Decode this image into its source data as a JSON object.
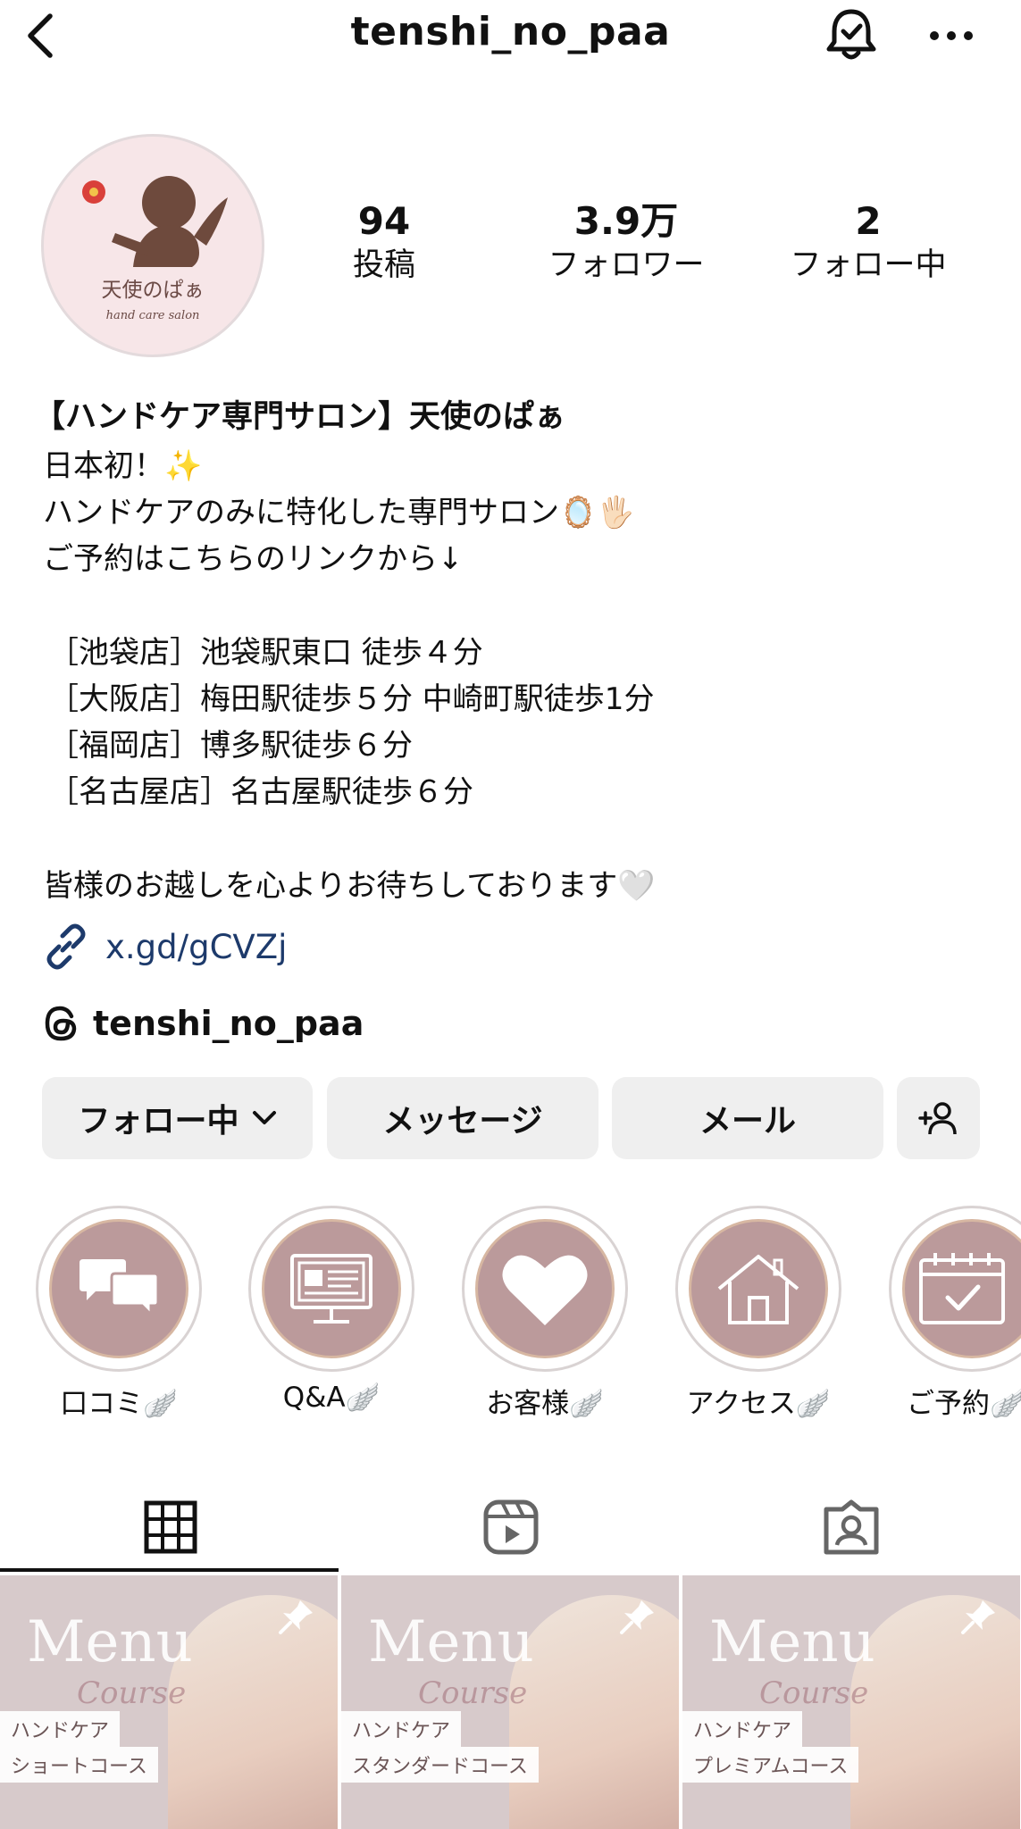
{
  "header": {
    "username": "tenshi_no_paa",
    "icons": {
      "back": "chevron-left-icon",
      "bell": "bell-check-icon",
      "more": "more-horizontal-icon"
    }
  },
  "profile": {
    "avatar": {
      "title": "天使のぱぁ",
      "subtitle": "hand care salon"
    },
    "stats": [
      {
        "value": "94",
        "label": "投稿"
      },
      {
        "value": "3.9万",
        "label": "フォロワー"
      },
      {
        "value": "2",
        "label": "フォロー中"
      }
    ],
    "full_name": "【ハンドケア専門サロン】天使のぱぁ",
    "bio": [
      "日本初！✨",
      "ハンドケアのみに特化した専門サロン🪞🖐🏻",
      "ご予約はこちらのリンクから↓",
      "［池袋店］池袋駅東口 徒歩４分",
      "［大阪店］梅田駅徒歩５分 中崎町駅徒歩1分",
      "［福岡店］博多駅徒歩６分",
      "［名古屋店］名古屋駅徒歩６分",
      "皆様のお越しを心よりお待ちしております🤍"
    ],
    "link": "x.gd/gCVZj",
    "threads": "tenshi_no_paa"
  },
  "buttons": {
    "following": "フォロー中",
    "message": "メッセージ",
    "email": "メール"
  },
  "highlights": [
    {
      "label": "口コミ🪽",
      "icon": "chat-bubbles-icon"
    },
    {
      "label": "Q&A🪽",
      "icon": "monitor-icon"
    },
    {
      "label": "お客様🪽",
      "icon": "heart-icon"
    },
    {
      "label": "アクセス🪽",
      "icon": "house-icon"
    },
    {
      "label": "ご予約🪽",
      "icon": "calendar-check-icon"
    }
  ],
  "tabs": [
    {
      "icon": "grid-icon",
      "active": true
    },
    {
      "icon": "reels-icon",
      "active": false
    },
    {
      "icon": "tagged-icon",
      "active": false
    }
  ],
  "posts": [
    {
      "menu": "Menu",
      "course": "Course",
      "line1": "ハンドケア",
      "line2": "ショートコース",
      "pinned": true
    },
    {
      "menu": "Menu",
      "course": "Course",
      "line1": "ハンドケア",
      "line2": "スタンダードコース",
      "pinned": true
    },
    {
      "menu": "Menu",
      "course": "Course",
      "line1": "ハンドケア",
      "line2": "プレミアムコース",
      "pinned": true
    }
  ],
  "colors": {
    "highlight_fill": "#bb9a9b",
    "link": "#1d3a6b",
    "button_bg": "#efefef"
  }
}
